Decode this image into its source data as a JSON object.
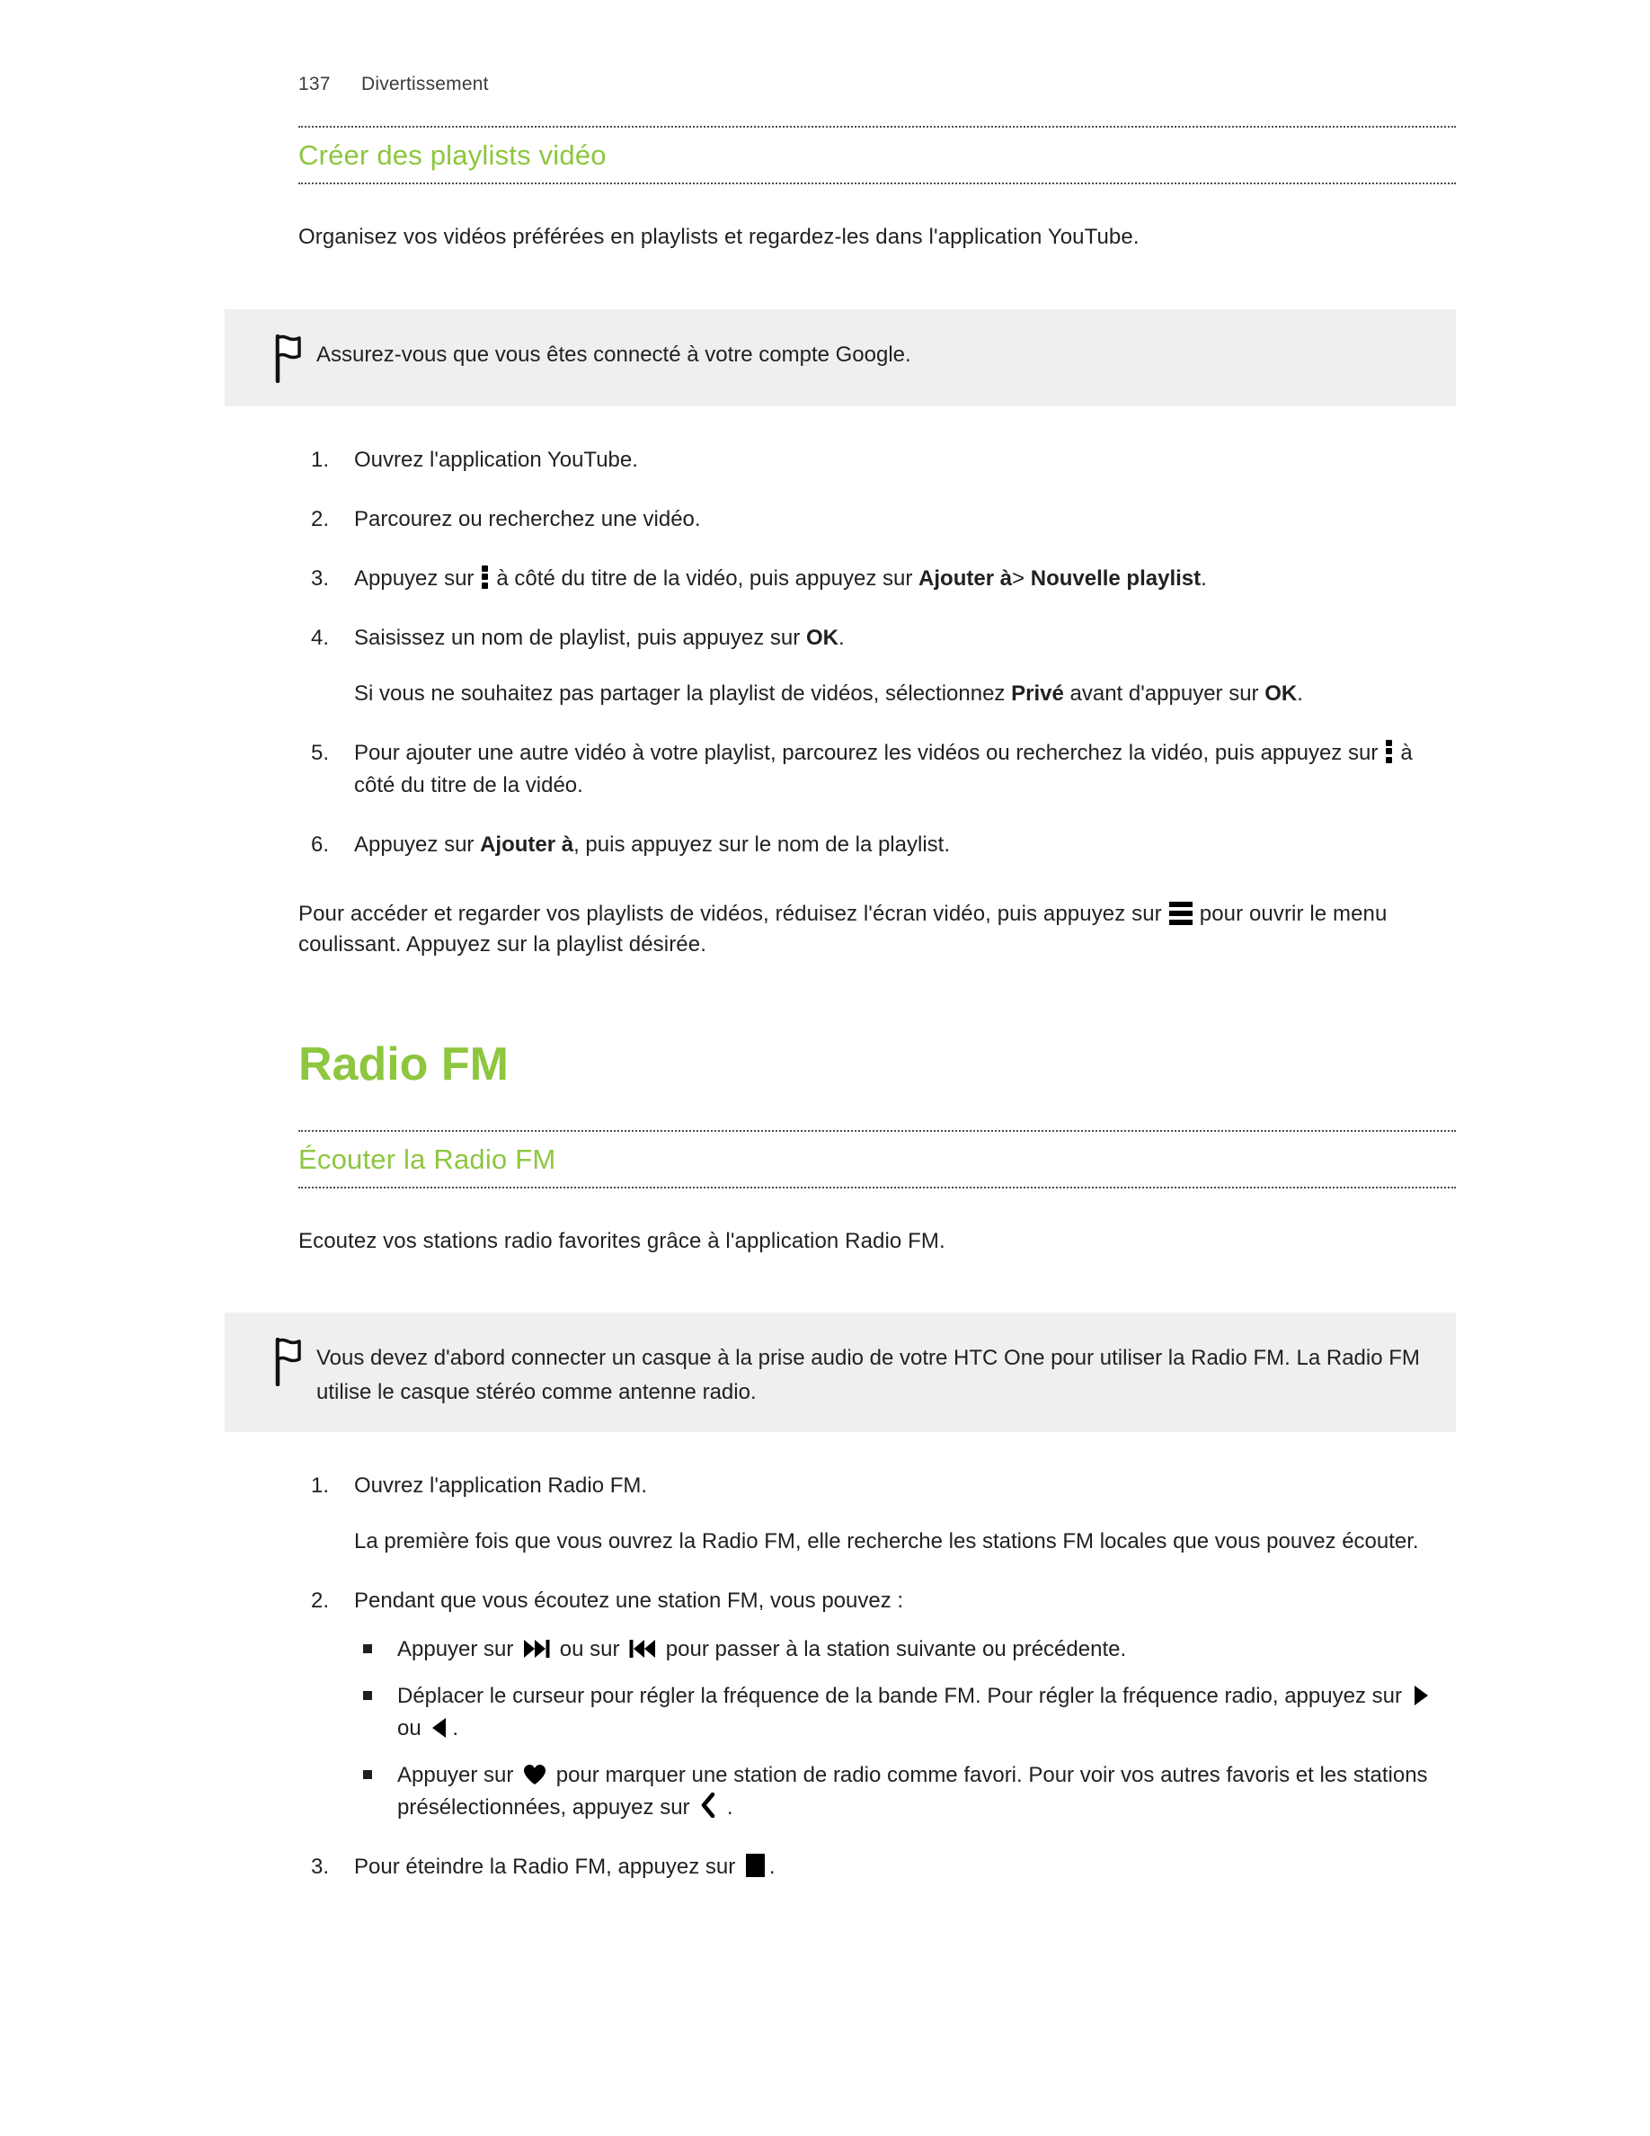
{
  "colors": {
    "accent_green": "#8DC63F",
    "note_background": "#EFEFEF",
    "body_text": "#231F20",
    "rule": "#4D4D4D"
  },
  "header": {
    "page_number": "137",
    "chapter": "Divertissement"
  },
  "sections": [
    {
      "id": "creer-playlists-video",
      "heading": "Créer des playlists vidéo",
      "intro": "Organisez vos vidéos préférées en playlists et regardez-les dans l'application YouTube.",
      "note": {
        "icon": "flag-icon",
        "text": "Assurez-vous que vous êtes connecté à votre compte Google."
      },
      "steps": [
        {
          "marker": "1.",
          "text": "Ouvrez l'application YouTube."
        },
        {
          "marker": "2.",
          "text": "Parcourez ou recherchez une vidéo."
        },
        {
          "marker": "3.",
          "text_before": "Appuyez sur",
          "icon": "kebab-menu-icon",
          "text_mid": "à côté du titre de la vidéo, puis appuyez sur",
          "bold1": "Ajouter à",
          "text_sep": ">",
          "bold2": "Nouvelle playlist",
          "text_after": "."
        },
        {
          "marker": "4.",
          "text_before": "Saisissez un nom de playlist, puis appuyez sur",
          "bold1": "OK",
          "text_after": ".",
          "sub_paragraph": {
            "text_before": "Si vous ne souhaitez pas partager la playlist de vidéos, sélectionnez",
            "bold1": "Privé",
            "text_mid": "avant d'appuyer sur",
            "bold2": "OK",
            "text_after": "."
          }
        },
        {
          "marker": "5.",
          "text_before": "Pour ajouter une autre vidéo à votre playlist, parcourez les vidéos ou recherchez la vidéo, puis appuyez sur",
          "icon": "kebab-menu-icon",
          "text_after": "à côté du titre de la vidéo."
        },
        {
          "marker": "6.",
          "text_before": "Appuyez sur",
          "bold1": "Ajouter à",
          "text_after": ", puis appuyez sur le nom de la playlist."
        }
      ],
      "closing": {
        "text_before": "Pour accéder et regarder vos playlists de vidéos, réduisez l'écran vidéo, puis appuyez sur",
        "icon": "hamburger-menu-icon",
        "text_after": "pour ouvrir le menu coulissant. Appuyez sur la playlist désirée."
      }
    },
    {
      "id": "radio-fm",
      "chapter_heading": "Radio FM",
      "heading": "Écouter la Radio FM",
      "intro": "Ecoutez vos stations radio favorites grâce à l'application Radio FM.",
      "note": {
        "icon": "flag-icon",
        "text": "Vous devez d'abord connecter un casque à la prise audio de votre HTC One pour utiliser la Radio FM. La Radio FM utilise le casque stéréo comme antenne radio."
      },
      "steps": [
        {
          "marker": "1.",
          "text": "Ouvrez l'application Radio FM.",
          "sub_paragraph_plain": "La première fois que vous ouvrez la Radio FM, elle recherche les stations FM locales que vous pouvez écouter."
        },
        {
          "marker": "2.",
          "text": "Pendant que vous écoutez une station FM, vous pouvez :",
          "bullets": [
            {
              "text_before": "Appuyer sur",
              "icon1": "next-track-icon",
              "text_mid": "ou sur",
              "icon2": "previous-track-icon",
              "text_after": "pour passer à la station suivante ou précédente."
            },
            {
              "text_before": "Déplacer le curseur pour régler la fréquence de la bande FM. Pour régler la fréquence radio, appuyez sur",
              "icon1": "play-right-triangle-icon",
              "text_mid": "ou",
              "icon2": "play-left-triangle-icon",
              "text_after": "."
            },
            {
              "text_before": "Appuyer sur",
              "icon1": "heart-icon",
              "text_mid": "pour marquer une station de radio comme favori. Pour voir vos autres favoris et les stations présélectionnées, appuyez sur",
              "icon2": "chevron-left-icon",
              "text_after": "."
            }
          ]
        },
        {
          "marker": "3.",
          "text_before": "Pour éteindre la Radio FM, appuyez sur",
          "icon": "stop-square-icon",
          "text_after": "."
        }
      ]
    }
  ]
}
